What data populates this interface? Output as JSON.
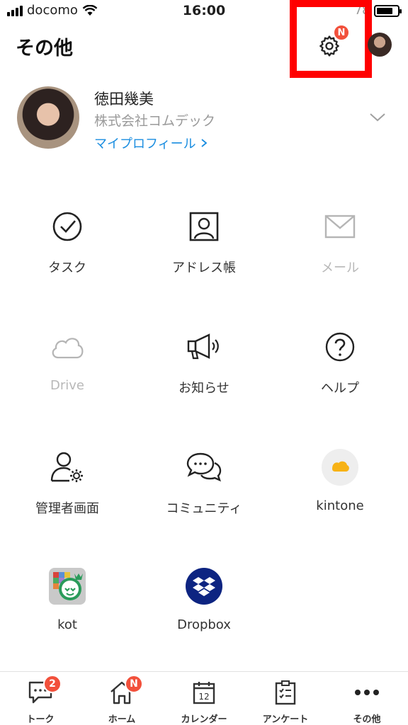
{
  "status_bar": {
    "carrier": "docomo",
    "time": "16:00",
    "battery_text": "78"
  },
  "header": {
    "title": "その他",
    "settings_badge": "N"
  },
  "profile": {
    "name": "徳田幾美",
    "company": "株式会社コムデック",
    "link_label": "マイプロフィール"
  },
  "grid": {
    "task": "タスク",
    "address_book": "アドレス帳",
    "mail": "メール",
    "drive": "Drive",
    "notice": "お知らせ",
    "help": "ヘルプ",
    "admin": "管理者画面",
    "community": "コミュニティ",
    "kintone": "kintone",
    "kot": "kot",
    "dropbox": "Dropbox"
  },
  "tabbar": {
    "talk": "トーク",
    "talk_badge": "2",
    "home": "ホーム",
    "home_badge": "N",
    "calendar": "カレンダー",
    "calendar_day": "12",
    "survey": "アンケート",
    "more": "その他"
  },
  "colors": {
    "accent_blue": "#1a8de0",
    "badge_red": "#f2503b",
    "highlight_red": "#ff0000",
    "dropbox_blue": "#0d2481"
  }
}
